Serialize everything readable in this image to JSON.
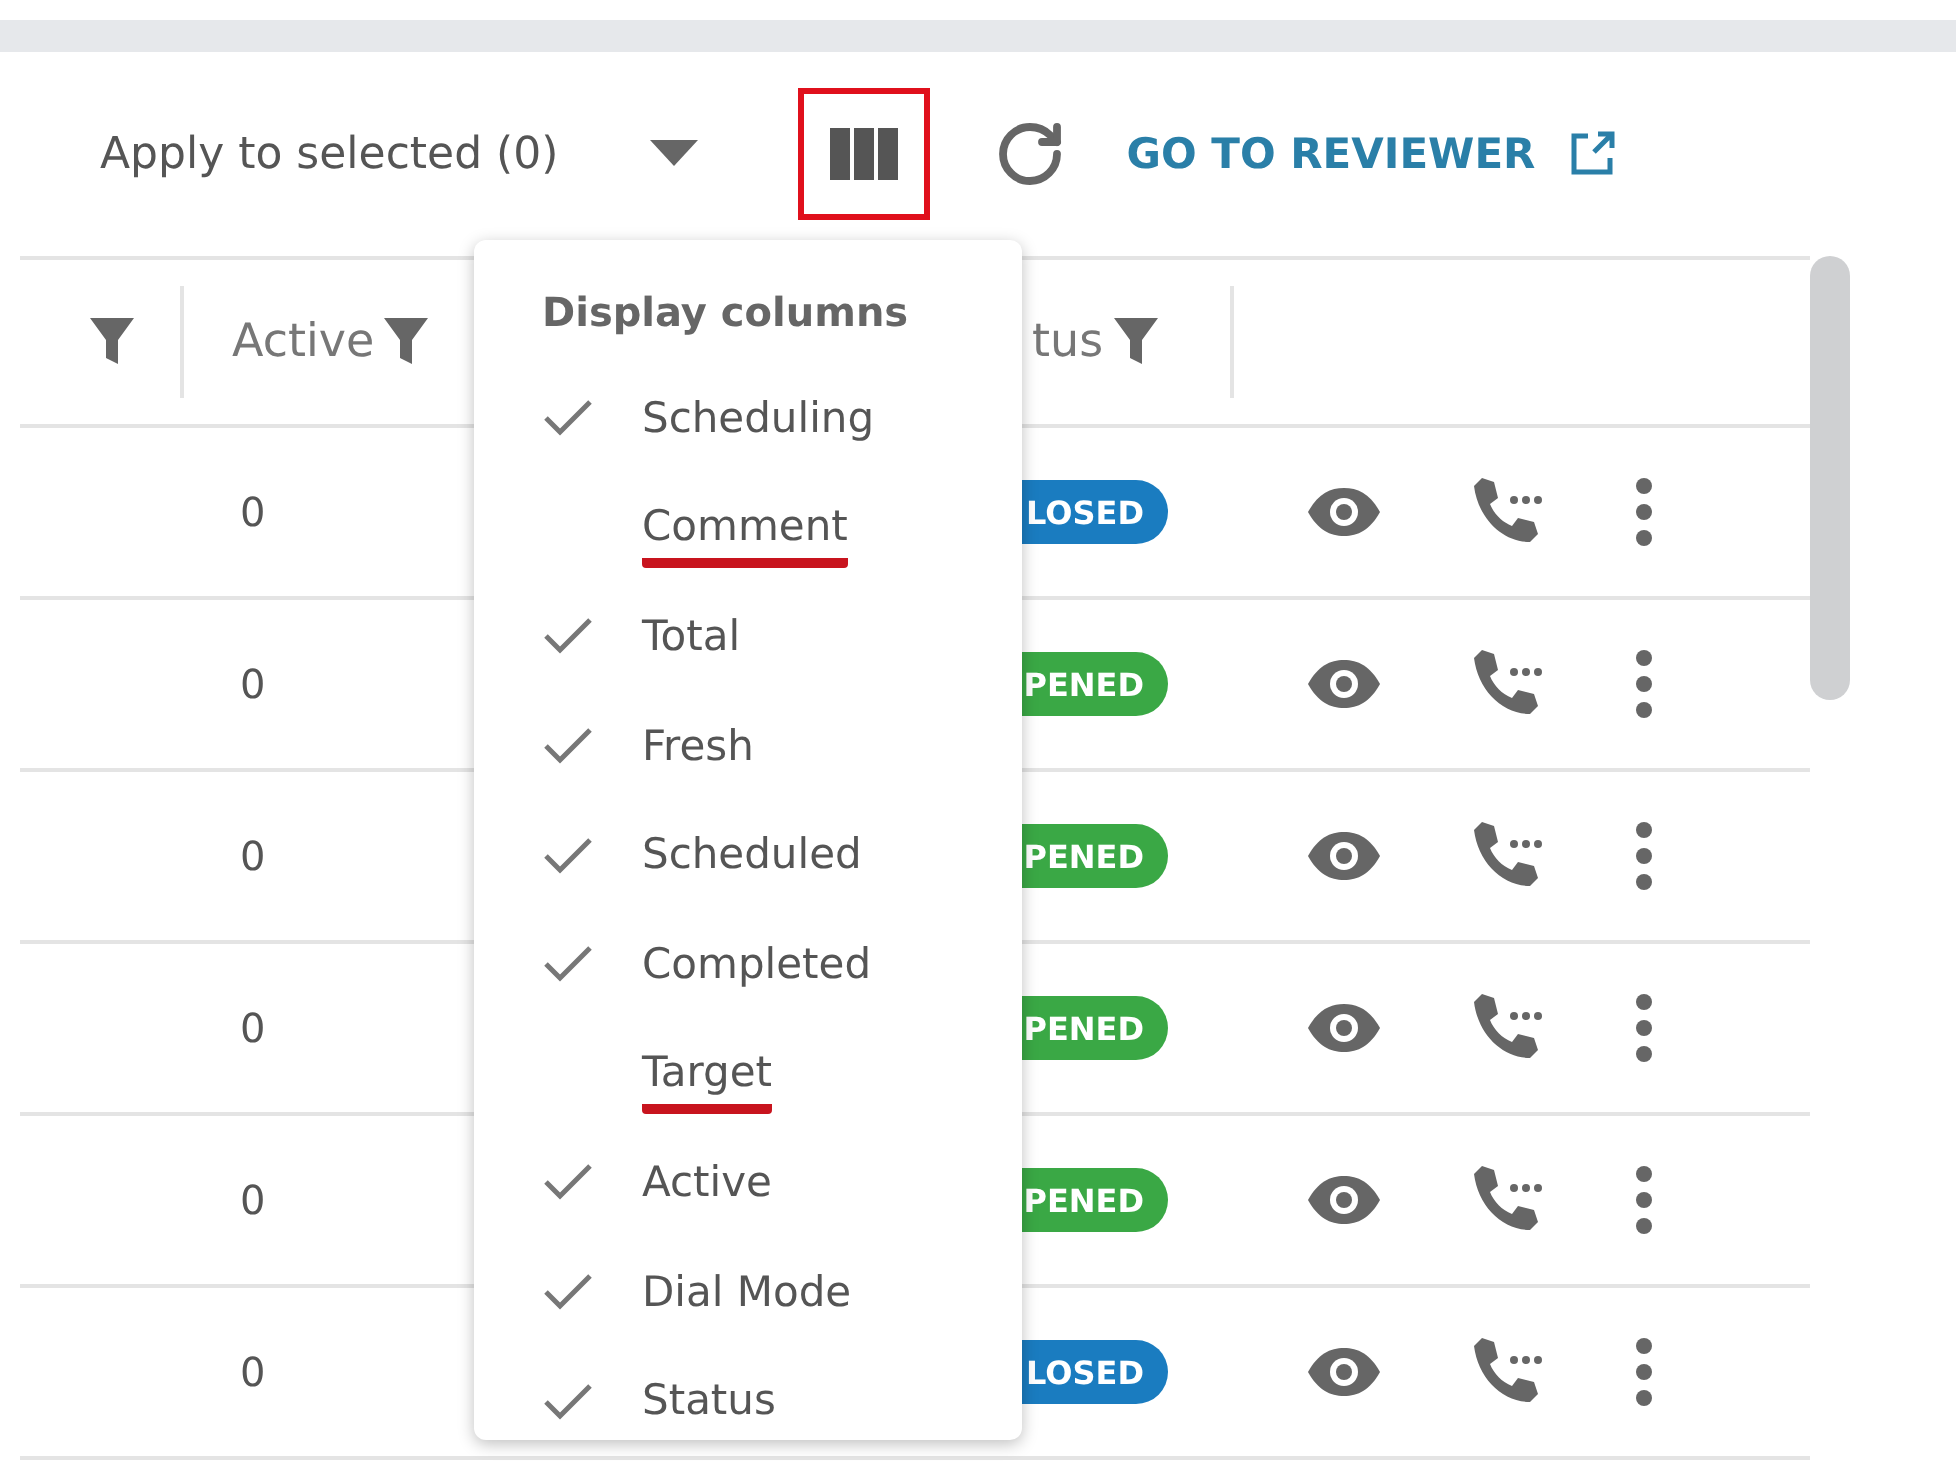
{
  "toolbar": {
    "apply_label": "Apply to selected (0)",
    "columns_button_highlighted": true,
    "reviewer_link": "GO TO REVIEWER"
  },
  "table": {
    "header": [
      {
        "kind": "filter"
      },
      {
        "kind": "labeled",
        "label": "Active"
      },
      {
        "kind": "labeled",
        "label": "tus"
      }
    ],
    "rows": [
      {
        "active": "0",
        "status": "LOSED",
        "color": "#1a7cc0"
      },
      {
        "active": "0",
        "status": "PENED",
        "color": "#3aa845"
      },
      {
        "active": "0",
        "status": "PENED",
        "color": "#3aa845"
      },
      {
        "active": "0",
        "status": "PENED",
        "color": "#3aa845"
      },
      {
        "active": "0",
        "status": "PENED",
        "color": "#3aa845"
      },
      {
        "active": "0",
        "status": "LOSED",
        "color": "#1a7cc0"
      }
    ]
  },
  "dropdown": {
    "title": "Display columns",
    "items": [
      {
        "label": "Scheduling",
        "checked": true,
        "highlighted": false
      },
      {
        "label": "Comment",
        "checked": false,
        "highlighted": true
      },
      {
        "label": "Total",
        "checked": true,
        "highlighted": false
      },
      {
        "label": "Fresh",
        "checked": true,
        "highlighted": false
      },
      {
        "label": "Scheduled",
        "checked": true,
        "highlighted": false
      },
      {
        "label": "Completed",
        "checked": true,
        "highlighted": false
      },
      {
        "label": "Target",
        "checked": false,
        "highlighted": true
      },
      {
        "label": "Active",
        "checked": true,
        "highlighted": false
      },
      {
        "label": "Dial Mode",
        "checked": true,
        "highlighted": false
      },
      {
        "label": "Status",
        "checked": true,
        "highlighted": false
      }
    ]
  }
}
